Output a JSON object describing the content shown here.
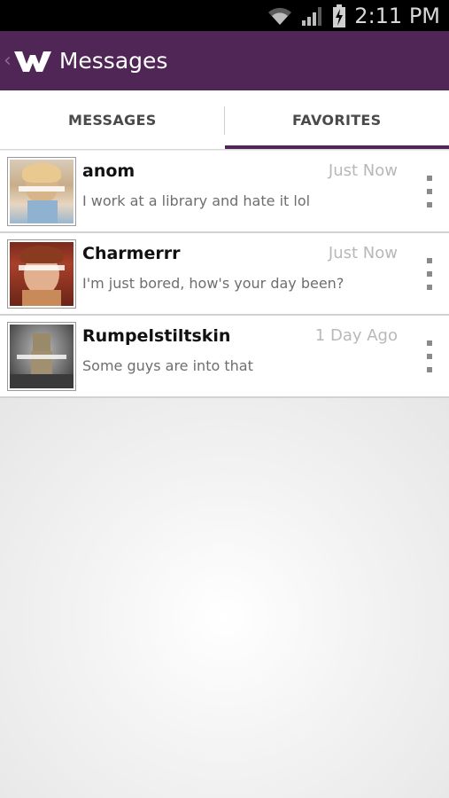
{
  "status_bar": {
    "time": "2:11 PM",
    "icons": [
      "wifi-icon",
      "signal-icon",
      "battery-charging-icon"
    ]
  },
  "action_bar": {
    "up_icon": "chevron-left-icon",
    "logo_icon": "w-logo-icon",
    "title": "Messages"
  },
  "tabs": [
    {
      "label": "MESSAGES",
      "selected": false
    },
    {
      "label": "FAVORITES",
      "selected": true
    }
  ],
  "conversations": [
    {
      "name": "anom",
      "time": "Just Now",
      "preview": "I work at a library and hate it lol",
      "avatar_icon": "user-photo-icon",
      "menu_icon": "overflow-menu-icon"
    },
    {
      "name": "Charmerrr",
      "time": "Just Now",
      "preview": "I'm just bored, how's your day been?",
      "avatar_icon": "user-photo-icon",
      "menu_icon": "overflow-menu-icon"
    },
    {
      "name": "Rumpelstiltskin",
      "time": "1 Day Ago",
      "preview": "Some guys are into that",
      "avatar_icon": "user-photo-icon",
      "menu_icon": "overflow-menu-icon"
    }
  ],
  "colors": {
    "brand": "#4f2655",
    "tab_indicator": "#4f2655",
    "status_bar": "#000000"
  }
}
